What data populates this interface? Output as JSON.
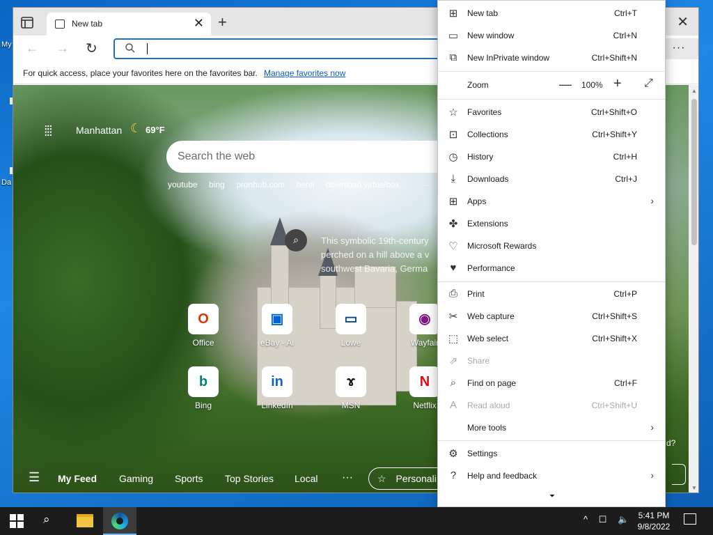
{
  "desktop": {
    "labels": [
      "My",
      "Da"
    ]
  },
  "browser": {
    "tab_title": "New tab",
    "tab_close": "✕",
    "new_tab_symbol": "+",
    "window_close": "✕",
    "nav_back": "←",
    "nav_forward": "→",
    "nav_refresh": "↻",
    "menu_button": "···",
    "favorites_bar_text": "For quick access, place your favorites here on the favorites bar.",
    "favorites_bar_link": "Manage favorites now"
  },
  "ntp": {
    "weather_city": "Manhattan",
    "weather_temp": "69°F",
    "search_placeholder": "Search the web",
    "quick_links": [
      "youtube",
      "bing",
      "pronhub.com",
      "henti",
      "download virtualbox"
    ],
    "quick_links_more": "···",
    "image_caption": "This symbolic 19th-century perched on a hill above a v southwest Bavaria, Germa",
    "tiles_row1": [
      {
        "label": "Office",
        "glyph": "O",
        "color": "#d83b01"
      },
      {
        "label": "eBay - Ai",
        "glyph": "▣",
        "color": "#0064d2"
      },
      {
        "label": "Lowe",
        "glyph": "▭",
        "color": "#004990"
      },
      {
        "label": "Wayfair",
        "glyph": "◉",
        "color": "#7f187f"
      }
    ],
    "tiles_row2": [
      {
        "label": "Bing",
        "glyph": "b",
        "color": "#008373"
      },
      {
        "label": "LinkedIn",
        "glyph": "in",
        "color": "#0a66c2"
      },
      {
        "label": "MSN",
        "glyph": "ɤ",
        "color": "#111111"
      },
      {
        "label": "Netflix",
        "glyph": "N",
        "color": "#e50914"
      }
    ],
    "feed": {
      "items": [
        "My Feed",
        "Gaming",
        "Sports",
        "Top Stories",
        "Local"
      ],
      "more": "···",
      "personalize": "Personali"
    },
    "side_text": "d?"
  },
  "menu": {
    "items": [
      {
        "label": "New tab",
        "shortcut": "Ctrl+T",
        "icon": "new-tab-icon",
        "glyph": "⊞"
      },
      {
        "label": "New window",
        "shortcut": "Ctrl+N",
        "icon": "new-window-icon",
        "glyph": "▭"
      },
      {
        "label": "New InPrivate window",
        "shortcut": "Ctrl+Shift+N",
        "icon": "inprivate-icon",
        "glyph": "⧉"
      },
      {
        "label": "Favorites",
        "shortcut": "Ctrl+Shift+O",
        "icon": "favorites-icon",
        "glyph": "☆"
      },
      {
        "label": "Collections",
        "shortcut": "Ctrl+Shift+Y",
        "icon": "collections-icon",
        "glyph": "⊡"
      },
      {
        "label": "History",
        "shortcut": "Ctrl+H",
        "icon": "history-icon",
        "glyph": "◷"
      },
      {
        "label": "Downloads",
        "shortcut": "Ctrl+J",
        "icon": "downloads-icon",
        "glyph": "⤓"
      },
      {
        "label": "Apps",
        "shortcut": "",
        "icon": "apps-icon",
        "glyph": "⊞",
        "arrow": "›"
      },
      {
        "label": "Extensions",
        "shortcut": "",
        "icon": "extensions-icon",
        "glyph": "✤"
      },
      {
        "label": "Microsoft Rewards",
        "shortcut": "",
        "icon": "rewards-icon",
        "glyph": "♡"
      },
      {
        "label": "Performance",
        "shortcut": "",
        "icon": "performance-icon",
        "glyph": "♥"
      },
      {
        "label": "Print",
        "shortcut": "Ctrl+P",
        "icon": "print-icon",
        "glyph": "⎙"
      },
      {
        "label": "Web capture",
        "shortcut": "Ctrl+Shift+S",
        "icon": "web-capture-icon",
        "glyph": "✂"
      },
      {
        "label": "Web select",
        "shortcut": "Ctrl+Shift+X",
        "icon": "web-select-icon",
        "glyph": "⬚"
      },
      {
        "label": "Share",
        "shortcut": "",
        "icon": "share-icon",
        "glyph": "⇗",
        "disabled": true
      },
      {
        "label": "Find on page",
        "shortcut": "Ctrl+F",
        "icon": "find-icon",
        "glyph": "⌕"
      },
      {
        "label": "Read aloud",
        "shortcut": "Ctrl+Shift+U",
        "icon": "read-aloud-icon",
        "glyph": "A",
        "disabled": true
      },
      {
        "label": "More tools",
        "shortcut": "",
        "icon": "more-tools-icon",
        "glyph": "",
        "arrow": "›"
      },
      {
        "label": "Settings",
        "shortcut": "",
        "icon": "settings-icon",
        "glyph": "⚙"
      },
      {
        "label": "Help and feedback",
        "shortcut": "",
        "icon": "help-icon",
        "glyph": "?",
        "arrow": "›"
      }
    ],
    "zoom": {
      "label": "Zoom",
      "minus": "—",
      "value": "100%",
      "plus": "+",
      "fullscreen": "⤢"
    },
    "more_indicator": "⏷"
  },
  "taskbar": {
    "clock_time": "5:41 PM",
    "clock_date": "9/8/2022",
    "tray_icons": "^ ☐ 🔈"
  }
}
